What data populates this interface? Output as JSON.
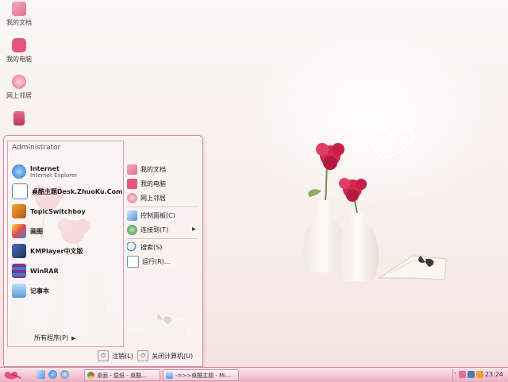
{
  "desktop": {
    "icons": [
      {
        "label": "我的文档",
        "icon": "my-documents-icon"
      },
      {
        "label": "我的电脑",
        "icon": "my-computer-icon"
      },
      {
        "label": "网上邻居",
        "icon": "network-icon"
      },
      {
        "label": "",
        "icon": "recycle-bin-icon"
      }
    ]
  },
  "start_menu": {
    "user": "Administrator",
    "pinned": [
      {
        "title": "Internet",
        "subtitle": "Internet Explorer",
        "icon": "ie-icon"
      },
      {
        "title": "桌酷主题Desk.ZhuoKu.Com",
        "subtitle": "",
        "icon": "zhuoku-icon"
      },
      {
        "title": "TopicSwitchboy",
        "subtitle": "",
        "icon": "topic-icon"
      },
      {
        "title": "画图",
        "subtitle": "",
        "icon": "paint-icon"
      },
      {
        "title": "KMPlayer中文版",
        "subtitle": "",
        "icon": "kmplayer-icon"
      },
      {
        "title": "WinRAR",
        "subtitle": "",
        "icon": "winrar-icon"
      },
      {
        "title": "记事本",
        "subtitle": "",
        "icon": "notepad-icon"
      }
    ],
    "all_programs": "所有程序(P)",
    "right": {
      "group1": [
        {
          "label": "我的文档",
          "icon": "my-documents-icon"
        },
        {
          "label": "我的电脑",
          "icon": "my-computer-icon"
        },
        {
          "label": "网上邻居",
          "icon": "network-icon"
        }
      ],
      "group2": [
        {
          "label": "控制面板(C)",
          "icon": "control-panel-icon"
        },
        {
          "label": "连接到(T)",
          "icon": "connect-icon"
        }
      ],
      "group3": [
        {
          "label": "搜索(S)",
          "icon": "search-icon"
        },
        {
          "label": "运行(R)...",
          "icon": "run-icon"
        }
      ]
    },
    "logoff": "注销(L)",
    "shutdown": "关闭计算机(U)"
  },
  "taskbar": {
    "tasks": [
      {
        "label": "桌面 - 壁纸 - 桌酷...",
        "icon": "chrome-icon"
      },
      {
        "label": "-=>>桌酷主题 - Mi...",
        "icon": "document-icon"
      }
    ],
    "clock": "23:24"
  },
  "colors": {
    "accent": "#e2708f",
    "menu_border": "#d98aa5",
    "taskbar": "#f4c2d3"
  }
}
